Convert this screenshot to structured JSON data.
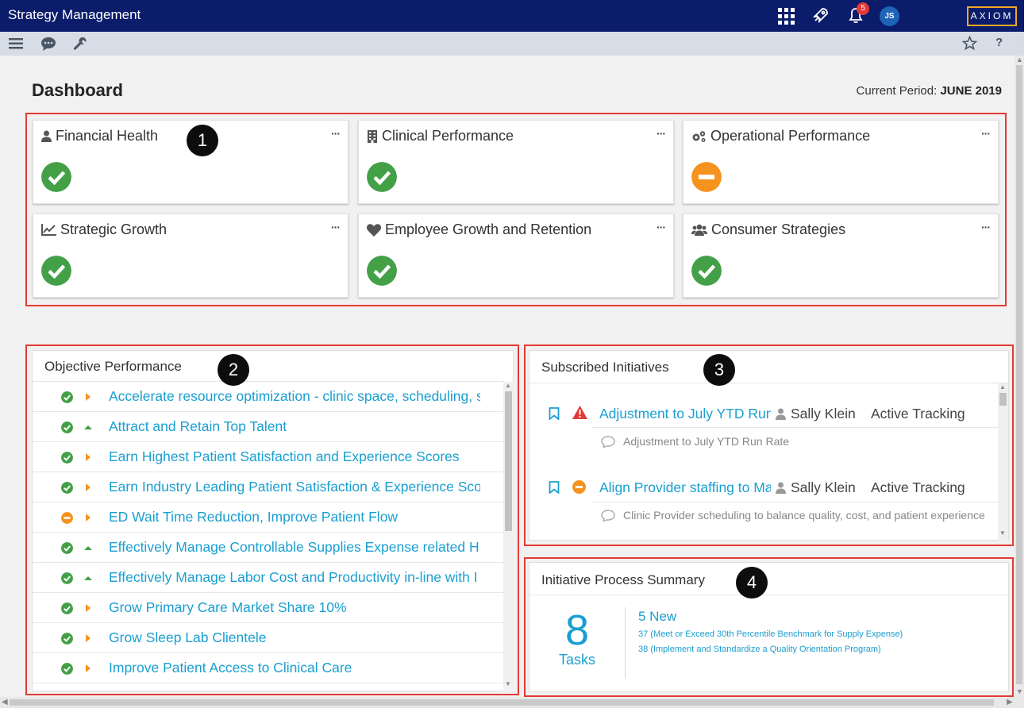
{
  "app": {
    "title": "Strategy Management",
    "notification_count": "5",
    "user_initials": "JS",
    "brand": "AXIOM"
  },
  "page": {
    "title": "Dashboard",
    "period_label": "Current Period:",
    "period_value": "JUNE 2019"
  },
  "colors": {
    "topbar": "#0b1c6b",
    "ok": "#43a047",
    "warning": "#f6921e",
    "link": "#1a9fd0",
    "highlight": "#e53935"
  },
  "markers": [
    "1",
    "2",
    "3",
    "4"
  ],
  "scorecards": [
    {
      "title": "Financial Health",
      "icon": "user-icon",
      "status": "ok"
    },
    {
      "title": "Clinical Performance",
      "icon": "building-icon",
      "status": "ok"
    },
    {
      "title": "Operational Performance",
      "icon": "gears-icon",
      "status": "warning"
    },
    {
      "title": "Strategic Growth",
      "icon": "line-chart-icon",
      "status": "ok"
    },
    {
      "title": "Employee Growth and Retention",
      "icon": "heart-icon",
      "status": "ok"
    },
    {
      "title": "Consumer Strategies",
      "icon": "users-icon",
      "status": "ok"
    }
  ],
  "objective_performance": {
    "title": "Objective Performance",
    "items": [
      {
        "label": "Accelerate resource optimization - clinic space, scheduling, staffing",
        "status": "ok",
        "trend": "right"
      },
      {
        "label": "Attract and Retain Top Talent",
        "status": "ok",
        "trend": "up"
      },
      {
        "label": "Earn Highest Patient Satisfaction and Experience Scores",
        "status": "ok",
        "trend": "right"
      },
      {
        "label": "Earn Industry Leading Patient Satisfaction & Experience Scores",
        "status": "ok",
        "trend": "right"
      },
      {
        "label": "ED Wait Time Reduction, Improve Patient Flow",
        "status": "warning",
        "trend": "right"
      },
      {
        "label": "Effectively Manage Controllable Supplies Expense related H",
        "status": "ok",
        "trend": "up"
      },
      {
        "label": "Effectively Manage Labor Cost and Productivity in-line with I",
        "status": "ok",
        "trend": "up"
      },
      {
        "label": "Grow Primary Care Market Share 10%",
        "status": "ok",
        "trend": "right"
      },
      {
        "label": "Grow Sleep Lab Clientele",
        "status": "ok",
        "trend": "right"
      },
      {
        "label": "Improve Patient Access to Clinical Care",
        "status": "ok",
        "trend": "right"
      }
    ]
  },
  "subscribed_initiatives": {
    "title": "Subscribed Initiatives",
    "items": [
      {
        "title": "Adjustment to July YTD Run Rate",
        "owner": "Sally Klein",
        "status": "Active Tracking",
        "description": "Adjustment to July YTD Run Rate",
        "alert": "error"
      },
      {
        "title": "Align Provider staffing to Match Demand",
        "owner": "Sally Klein",
        "status": "Active Tracking",
        "description": "Clinic Provider scheduling to balance quality, cost, and patient experience",
        "alert": "warning"
      }
    ]
  },
  "process_summary": {
    "title": "Initiative Process Summary",
    "task_count": "8",
    "task_label": "Tasks",
    "new_label": "5 New",
    "new_items": [
      "37 (Meet or Exceed 30th Percentile Benchmark for Supply Expense)",
      "38 (Implement and Standardize a Quality Orientation Program)"
    ]
  }
}
